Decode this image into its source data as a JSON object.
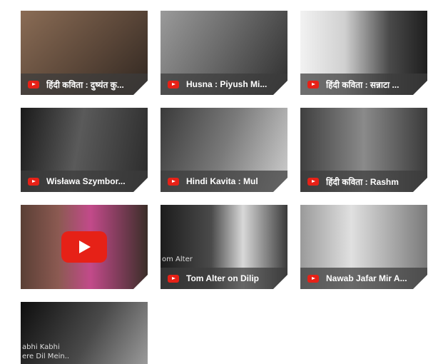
{
  "videos": [
    {
      "title": "हिंदी कविता : दुष्यंत कु...",
      "thumb_color": "#6e5a4b"
    },
    {
      "title": "Husna : Piyush Mi...",
      "thumb_color": "#5b5b5b"
    },
    {
      "title": "हिंदी कविता : सन्नाटा ...",
      "thumb_color": "#7a7a7a"
    },
    {
      "title": "Wisława Szymbor...",
      "thumb_color": "#3a3a3a"
    },
    {
      "title": "Hindi Kavita : Mul",
      "thumb_color": "#4a4a4a"
    },
    {
      "title": "हिंदी कविता : Rashm",
      "thumb_color": "#5a5a5a"
    },
    {
      "title": "",
      "thumb_color": "#6a3b3b"
    },
    {
      "title": "Tom Alter on Dilip",
      "thumb_color": "#4f4f4f"
    },
    {
      "title": "Nawab Jafar Mir A...",
      "thumb_color": "#6b6b6b"
    },
    {
      "title": "",
      "thumb_color": "#2a2a2a"
    }
  ],
  "overlays": {
    "tile7_text": "om Alter",
    "tile10_line1": "abhi Kabhi",
    "tile10_line2": "ere Dil Mein.."
  },
  "colors": {
    "youtube_red": "#e62117",
    "caption_bg": "rgba(60,60,60,0.72)"
  }
}
